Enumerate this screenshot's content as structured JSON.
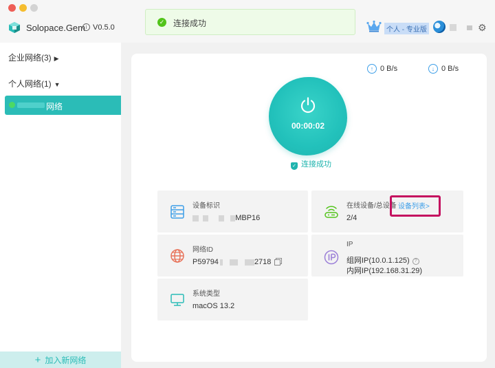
{
  "app": {
    "name": "Solopace.Gem",
    "version": "V0.5.0"
  },
  "toast": {
    "text": "连接成功"
  },
  "user": {
    "plan_badge": "个人 - 专业版"
  },
  "sidebar": {
    "groups": [
      {
        "label": "企业网络(3)",
        "expanded": false
      },
      {
        "label": "个人网络(1)",
        "expanded": true
      }
    ],
    "networks": [
      {
        "label": "网络",
        "active": true
      }
    ],
    "add_button": "加入新网络"
  },
  "traffic": {
    "upload": "0 B/s",
    "download": "0 B/s"
  },
  "connection": {
    "timer": "00:00:02",
    "status": "连接成功"
  },
  "cards": {
    "device": {
      "label": "设备标识",
      "value_suffix": "MBP16"
    },
    "online": {
      "label": "在线设备/总设备",
      "link": "设备列表>",
      "value": "2/4"
    },
    "netid": {
      "label": "网络ID",
      "value_prefix": "P59794",
      "value_suffix": "2718"
    },
    "ip": {
      "label": "IP",
      "lan_ip": "组网IP(10.0.1.125)",
      "local_ip": "内网IP(192.168.31.29)"
    },
    "os": {
      "label": "系统类型",
      "value": "macOS 13.2"
    }
  },
  "colors": {
    "accent": "#2bbcb7",
    "success": "#52c41a",
    "link": "#3d9ee8",
    "highlight": "#c4105f"
  }
}
